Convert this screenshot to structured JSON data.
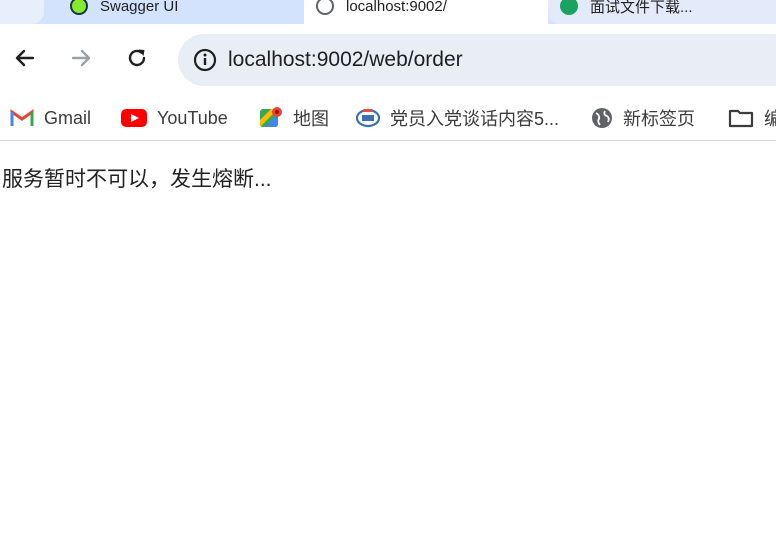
{
  "tabs": [
    {
      "label": ""
    },
    {
      "label": "Swagger UI"
    },
    {
      "label": "localhost:9002/"
    },
    {
      "label": "面试文件下载..."
    }
  ],
  "toolbar": {
    "url": "localhost:9002/web/order"
  },
  "bookmarks": [
    {
      "label": "Gmail",
      "icon": "gmail-icon"
    },
    {
      "label": "YouTube",
      "icon": "youtube-icon"
    },
    {
      "label": "地图",
      "icon": "maps-icon"
    },
    {
      "label": "党员入党谈话内容5...",
      "icon": "site-icon"
    },
    {
      "label": "新标签页",
      "icon": "globe-icon"
    },
    {
      "label": "编",
      "icon": "folder-icon"
    }
  ],
  "page": {
    "message": "服务暂时不可以，发生熔断..."
  },
  "colors": {
    "tabstrip": "#d3e3fd",
    "omnibox": "#e9eef6",
    "youtube_red": "#ff0000",
    "gmail_red": "#ea4335"
  }
}
